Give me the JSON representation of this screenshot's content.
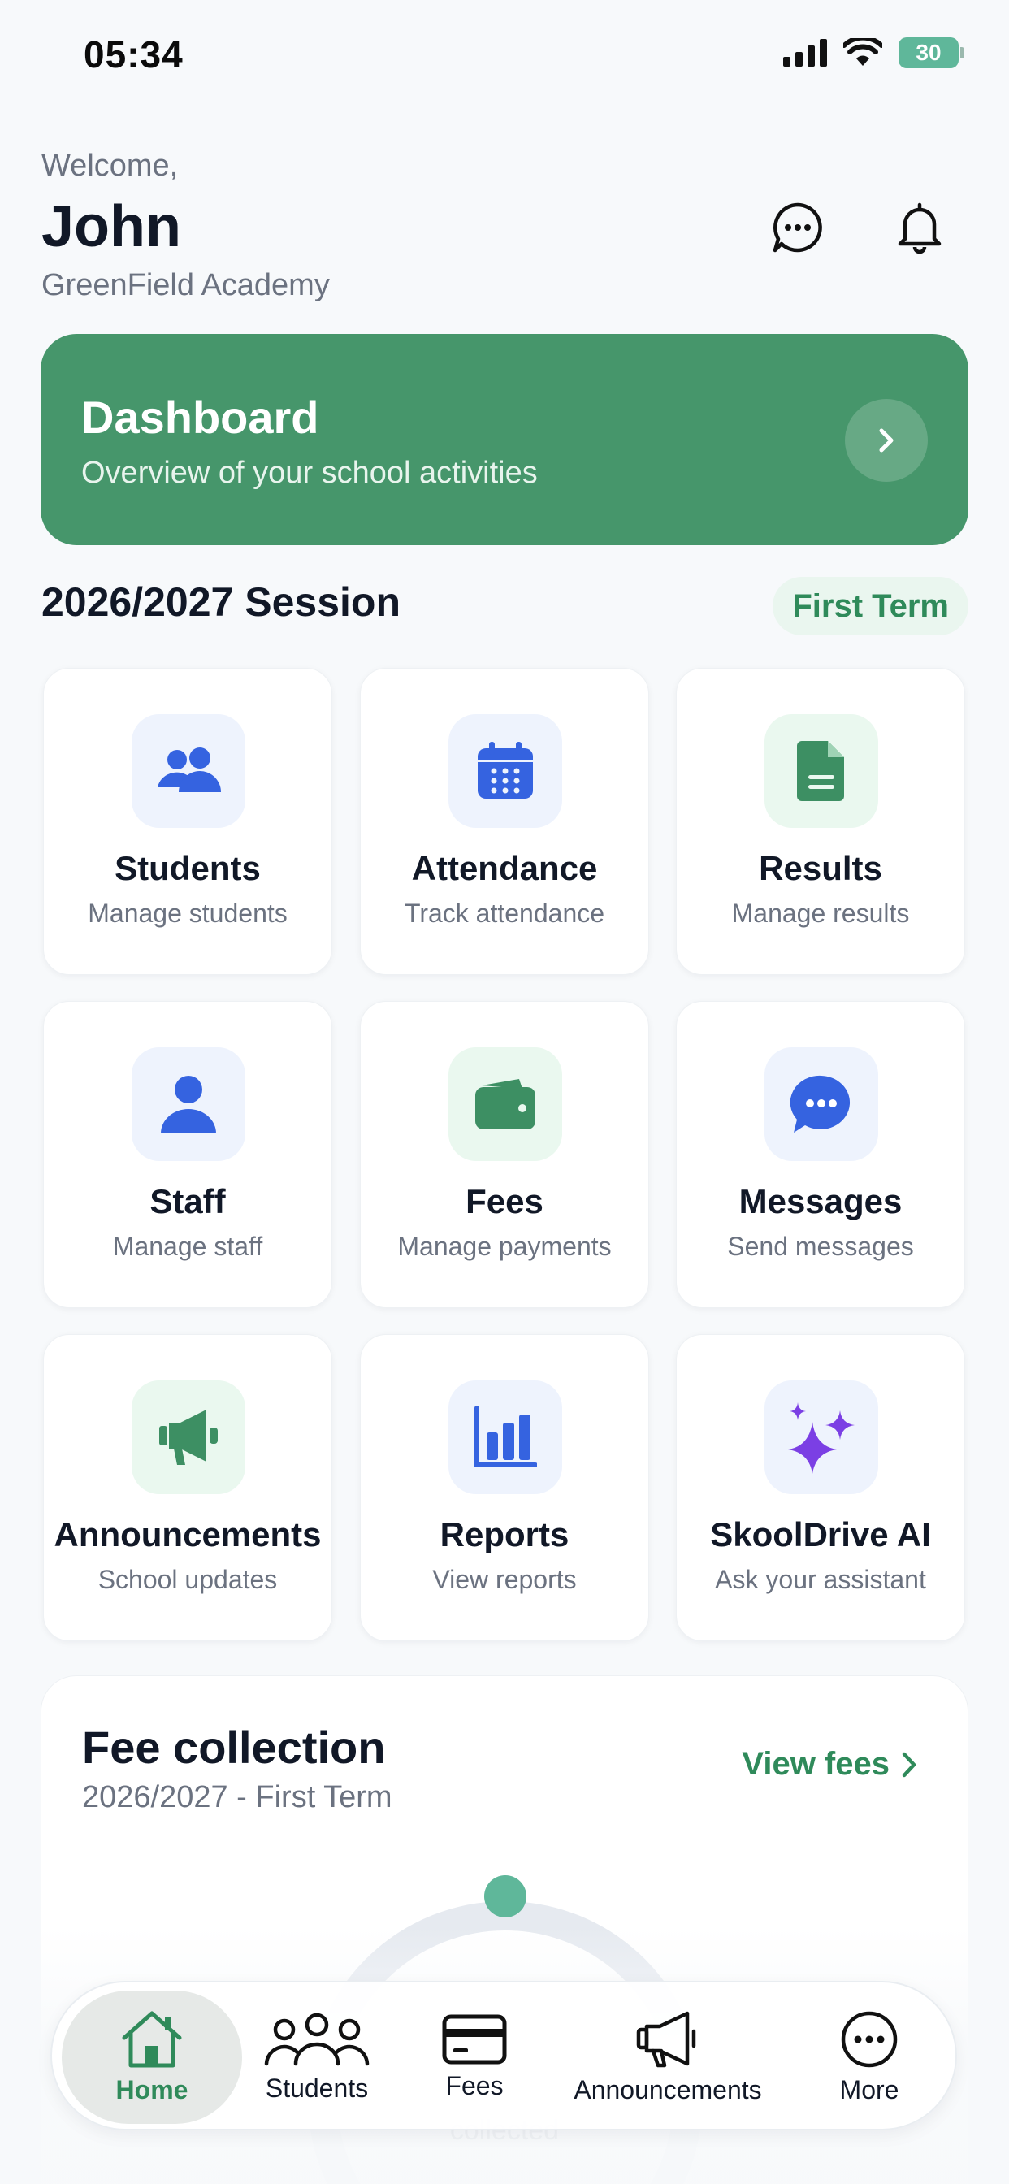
{
  "status_bar": {
    "time": "05:34",
    "battery": "30"
  },
  "header": {
    "greeting": "Welcome,",
    "name": "John",
    "school": "GreenField Academy"
  },
  "banner": {
    "title": "Dashboard",
    "subtitle": "Overview of your school activities"
  },
  "session": {
    "title": "2026/2027 Session",
    "term": "First Term"
  },
  "tiles": [
    {
      "title": "Students",
      "subtitle": "Manage students",
      "icon": "students-icon"
    },
    {
      "title": "Attendance",
      "subtitle": "Track attendance",
      "icon": "calendar-icon"
    },
    {
      "title": "Results",
      "subtitle": "Manage results",
      "icon": "document-icon"
    },
    {
      "title": "Staff",
      "subtitle": "Manage staff",
      "icon": "person-icon"
    },
    {
      "title": "Fees",
      "subtitle": "Manage payments",
      "icon": "wallet-icon"
    },
    {
      "title": "Messages",
      "subtitle": "Send messages",
      "icon": "chat-icon"
    },
    {
      "title": "Announcements",
      "subtitle": "School updates",
      "icon": "megaphone-icon"
    },
    {
      "title": "Reports",
      "subtitle": "View reports",
      "icon": "bar-chart-icon"
    },
    {
      "title": "SkoolDrive AI",
      "subtitle": "Ask your assistant",
      "icon": "sparkles-icon"
    }
  ],
  "fee_card": {
    "title": "Fee collection",
    "subtitle": "2026/2027 - First Term",
    "link": "View fees",
    "caption": "collected"
  },
  "nav": [
    {
      "label": "Home",
      "icon": "home-icon",
      "active": true
    },
    {
      "label": "Students",
      "icon": "students-icon"
    },
    {
      "label": "Fees",
      "icon": "card-icon"
    },
    {
      "label": "Announcements",
      "icon": "megaphone-icon"
    },
    {
      "label": "More",
      "icon": "more-icon"
    }
  ],
  "colors": {
    "brand_green": "#46966b",
    "accent_blue": "#3563e0",
    "accent_purple": "#7b3fe4"
  }
}
